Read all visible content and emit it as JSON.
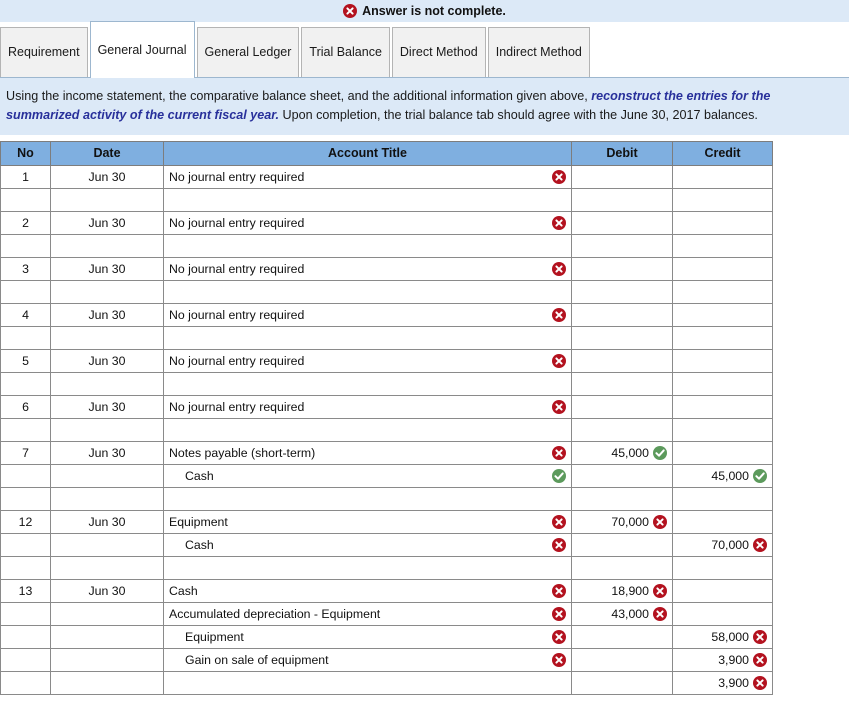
{
  "banner": {
    "icon": "error-circle-icon",
    "text": "Answer is not complete."
  },
  "tabs": [
    {
      "label": "Requirement",
      "active": false
    },
    {
      "label": "General Journal",
      "active": true
    },
    {
      "label": "General Ledger",
      "active": false
    },
    {
      "label": "Trial Balance",
      "active": false
    },
    {
      "label": "Direct Method",
      "active": false
    },
    {
      "label": "Indirect Method",
      "active": false
    }
  ],
  "instructions": {
    "part1": "Using the income statement, the comparative balance sheet, and the additional information given above, ",
    "emphasis": "reconstruct the entries for the summarized activity of the current fiscal year.",
    "part2": "  Upon completion, the trial balance tab should agree with the June 30, 2017 balances."
  },
  "colors": {
    "banner_bg": "#dce9f7",
    "header_bg": "#7fafe0",
    "error_red": "#b3121f",
    "correct_green": "#5c9a5c",
    "bad_cell_bg": "#fdf3f2",
    "good_cell_bg": "#f5faf4",
    "emphasis_text": "#28309b"
  },
  "table": {
    "columns": [
      "No",
      "Date",
      "Account Title",
      "Debit",
      "Credit"
    ],
    "rows": [
      {
        "no": "1",
        "date": "Jun 30",
        "title": "No journal entry required",
        "title_mark": "error",
        "indent": 0,
        "debit": "",
        "debit_mark": "",
        "credit": "",
        "credit_mark": ""
      },
      {
        "no": "",
        "date": "",
        "title": "",
        "title_mark": "",
        "indent": 0,
        "debit": "",
        "debit_mark": "",
        "credit": "",
        "credit_mark": "",
        "spacer": true
      },
      {
        "no": "2",
        "date": "Jun 30",
        "title": "No journal entry required",
        "title_mark": "error",
        "indent": 0,
        "debit": "",
        "debit_mark": "",
        "credit": "",
        "credit_mark": ""
      },
      {
        "no": "",
        "date": "",
        "title": "",
        "title_mark": "",
        "indent": 0,
        "debit": "",
        "debit_mark": "",
        "credit": "",
        "credit_mark": "",
        "spacer": true
      },
      {
        "no": "3",
        "date": "Jun 30",
        "title": "No journal entry required",
        "title_mark": "error",
        "indent": 0,
        "debit": "",
        "debit_mark": "",
        "credit": "",
        "credit_mark": ""
      },
      {
        "no": "",
        "date": "",
        "title": "",
        "title_mark": "",
        "indent": 0,
        "debit": "",
        "debit_mark": "",
        "credit": "",
        "credit_mark": "",
        "spacer": true
      },
      {
        "no": "4",
        "date": "Jun 30",
        "title": "No journal entry required",
        "title_mark": "error",
        "indent": 0,
        "debit": "",
        "debit_mark": "",
        "credit": "",
        "credit_mark": ""
      },
      {
        "no": "",
        "date": "",
        "title": "",
        "title_mark": "",
        "indent": 0,
        "debit": "",
        "debit_mark": "",
        "credit": "",
        "credit_mark": "",
        "spacer": true
      },
      {
        "no": "5",
        "date": "Jun 30",
        "title": "No journal entry required",
        "title_mark": "error",
        "indent": 0,
        "debit": "",
        "debit_mark": "",
        "credit": "",
        "credit_mark": ""
      },
      {
        "no": "",
        "date": "",
        "title": "",
        "title_mark": "",
        "indent": 0,
        "debit": "",
        "debit_mark": "",
        "credit": "",
        "credit_mark": "",
        "spacer": true
      },
      {
        "no": "6",
        "date": "Jun 30",
        "title": "No journal entry required",
        "title_mark": "error",
        "indent": 0,
        "debit": "",
        "debit_mark": "",
        "credit": "",
        "credit_mark": ""
      },
      {
        "no": "",
        "date": "",
        "title": "",
        "title_mark": "",
        "indent": 0,
        "debit": "",
        "debit_mark": "",
        "credit": "",
        "credit_mark": "",
        "spacer": true
      },
      {
        "no": "7",
        "date": "Jun 30",
        "title": "Notes payable (short-term)",
        "title_mark": "error",
        "indent": 0,
        "debit": "45,000",
        "debit_mark": "correct",
        "credit": "",
        "credit_mark": ""
      },
      {
        "no": "",
        "date": "",
        "title": "Cash",
        "title_mark": "correct",
        "indent": 1,
        "debit": "",
        "debit_mark": "",
        "credit": "45,000",
        "credit_mark": "correct"
      },
      {
        "no": "",
        "date": "",
        "title": "",
        "title_mark": "",
        "indent": 0,
        "debit": "",
        "debit_mark": "",
        "credit": "",
        "credit_mark": "",
        "spacer": true
      },
      {
        "no": "12",
        "date": "Jun 30",
        "title": "Equipment",
        "title_mark": "error",
        "indent": 0,
        "debit": "70,000",
        "debit_mark": "error",
        "credit": "",
        "credit_mark": ""
      },
      {
        "no": "",
        "date": "",
        "title": "Cash",
        "title_mark": "error",
        "indent": 1,
        "debit": "",
        "debit_mark": "",
        "credit": "70,000",
        "credit_mark": "error"
      },
      {
        "no": "",
        "date": "",
        "title": "",
        "title_mark": "",
        "indent": 0,
        "debit": "",
        "debit_mark": "",
        "credit": "",
        "credit_mark": "",
        "spacer": true
      },
      {
        "no": "13",
        "date": "Jun 30",
        "title": "Cash",
        "title_mark": "error",
        "indent": 0,
        "debit": "18,900",
        "debit_mark": "error",
        "credit": "",
        "credit_mark": ""
      },
      {
        "no": "",
        "date": "",
        "title": "Accumulated depreciation - Equipment",
        "title_mark": "error",
        "indent": 0,
        "debit": "43,000",
        "debit_mark": "error",
        "credit": "",
        "credit_mark": ""
      },
      {
        "no": "",
        "date": "",
        "title": "Equipment",
        "title_mark": "error",
        "indent": 1,
        "debit": "",
        "debit_mark": "",
        "credit": "58,000",
        "credit_mark": "error"
      },
      {
        "no": "",
        "date": "",
        "title": "Gain on sale of equipment",
        "title_mark": "error",
        "indent": 1,
        "debit": "",
        "debit_mark": "",
        "credit": "3,900",
        "credit_mark": "error"
      },
      {
        "no": "",
        "date": "",
        "title": "",
        "title_mark": "",
        "indent": 0,
        "debit": "",
        "debit_mark": "",
        "credit": "3,900",
        "credit_mark": "error"
      }
    ]
  }
}
